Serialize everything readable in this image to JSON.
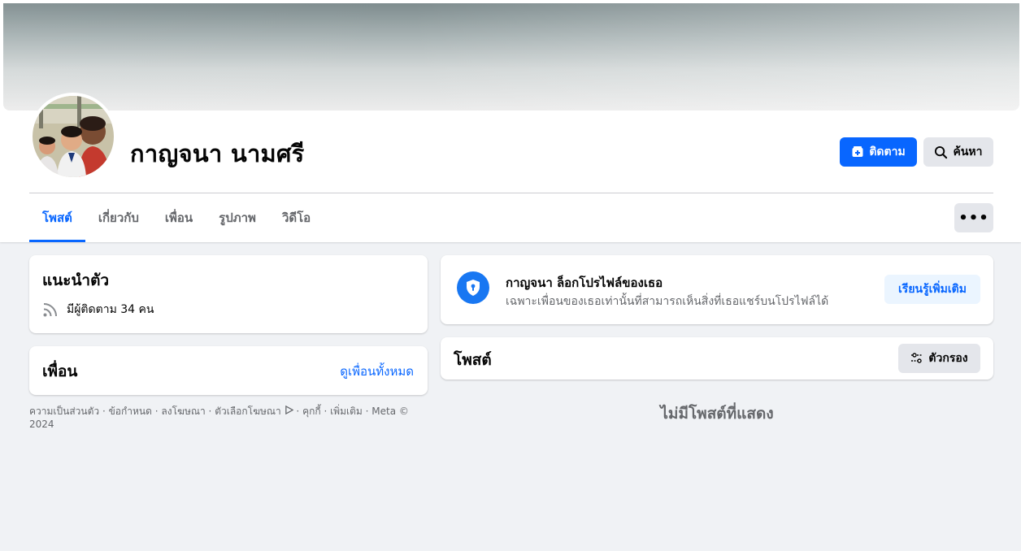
{
  "profile": {
    "name": "กาญจนา นามศรี",
    "follow_label": "ติดตาม",
    "search_label": "ค้นหา"
  },
  "tabs": [
    {
      "label": "โพสต์",
      "active": true
    },
    {
      "label": "เกี่ยวกับ",
      "active": false
    },
    {
      "label": "เพื่อน",
      "active": false
    },
    {
      "label": "รูปภาพ",
      "active": false
    },
    {
      "label": "วิดีโอ",
      "active": false
    }
  ],
  "more_label": "•••",
  "intro": {
    "title": "แนะนำตัว",
    "followers": "มีผู้ติดตาม 34 คน"
  },
  "friends": {
    "title": "เพื่อน",
    "see_all": "ดูเพื่อนทั้งหมด"
  },
  "footer": {
    "privacy": "ความเป็นส่วนตัว",
    "terms": "ข้อกำหนด",
    "ads": "ลงโฆษณา",
    "ad_choices": "ตัวเลือกโฆษณา",
    "cookies": "คุกกี้",
    "more": "เพิ่มเติม",
    "copyright": "Meta © 2024"
  },
  "lock_notice": {
    "title": "กาญจนา ล็อกโปรไฟล์ของเธอ",
    "subtitle": "เฉพาะเพื่อนของเธอเท่านั้นที่สามารถเห็นสิ่งที่เธอแชร์บนโปรไฟล์ได้",
    "learn_more": "เรียนรู้เพิ่มเติม"
  },
  "posts": {
    "title": "โพสต์",
    "filter_label": "ตัวกรอง",
    "empty_text": "ไม่มีโพสต์ที่แสดง"
  },
  "colors": {
    "accent": "#0866ff",
    "background": "#f0f2f5",
    "secondary_text": "#65676b"
  }
}
